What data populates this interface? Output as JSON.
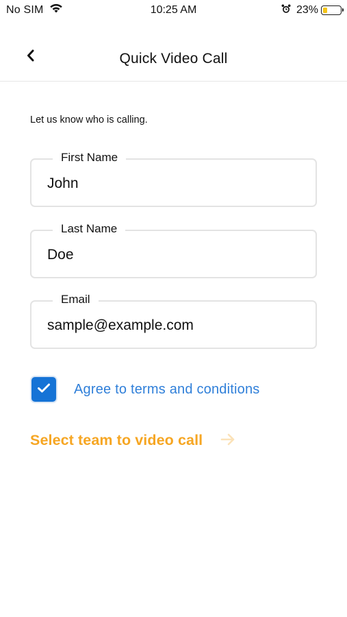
{
  "status_bar": {
    "carrier": "No SIM",
    "time": "10:25 AM",
    "battery_percent": "23%",
    "battery_level": 0.23,
    "icons": [
      "wifi-icon",
      "alarm-icon",
      "battery-icon"
    ]
  },
  "nav": {
    "title": "Quick Video Call",
    "back_icon": "chevron-left-icon"
  },
  "form": {
    "intro": "Let us know who is calling.",
    "first_name": {
      "label": "First Name",
      "value": "John"
    },
    "last_name": {
      "label": "Last Name",
      "value": "Doe"
    },
    "email": {
      "label": "Email",
      "value": "sample@example.com"
    },
    "agree": {
      "label": "Agree to terms and conditions",
      "checked": true
    }
  },
  "action": {
    "label": "Select team to video call",
    "icon": "arrow-right-icon"
  },
  "colors": {
    "accent_blue": "#1573d6",
    "link_blue": "#2f7fd9",
    "action_orange": "#f6a623",
    "arrow_light_orange": "#fbe2b8",
    "battery_yellow": "#f5c518",
    "border_gray": "#e3e3e3"
  }
}
